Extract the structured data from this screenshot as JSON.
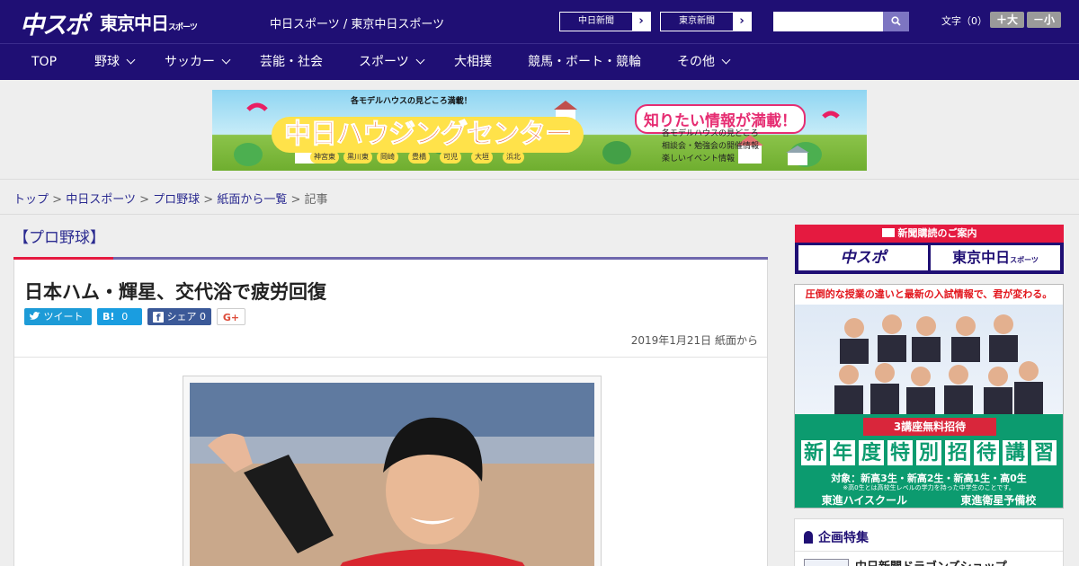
{
  "header": {
    "logo_chuspo": "中スポ",
    "logo_tokyo": "東京中日",
    "logo_tokyo_small": "スポーツ",
    "site_title": "中日スポーツ / 東京中日スポーツ",
    "ext_links": [
      "中日新聞",
      "東京新聞"
    ],
    "search_placeholder": "",
    "fontsize_label": "文字（0）",
    "fontsize_up": "＋大",
    "fontsize_down": "－小"
  },
  "nav": {
    "items": [
      {
        "label": "TOP",
        "has_menu": false
      },
      {
        "label": "野球",
        "has_menu": true
      },
      {
        "label": "サッカー",
        "has_menu": true
      },
      {
        "label": "芸能・社会",
        "has_menu": false
      },
      {
        "label": "スポーツ",
        "has_menu": true
      },
      {
        "label": "大相撲",
        "has_menu": false
      },
      {
        "label": "競馬・ボート・競輪",
        "has_menu": false
      },
      {
        "label": "その他",
        "has_menu": true
      }
    ]
  },
  "banner": {
    "top_text": "各モデルハウスの見どころ満載！",
    "title": "中日ハウジングセンター",
    "right_head": "知りたい情報が満載！",
    "lines": [
      "各モデルハウスの見どころ",
      "相談会・勉強会の開催情報",
      "楽しいイベント情報"
    ],
    "cities": [
      "神宮東",
      "黒川東",
      "岡崎",
      "豊橋",
      "可児",
      "大垣",
      "浜北"
    ]
  },
  "breadcrumb": {
    "items": [
      "トップ",
      "中日スポーツ",
      "プロ野球",
      "紙面から一覧"
    ],
    "current": "記事",
    "separator": ">"
  },
  "article": {
    "category": "【プロ野球】",
    "headline": "日本ハム・輝星、交代浴で疲労回復",
    "share": {
      "tweet": "ツイート",
      "hatena_label": "B!",
      "hatena_count": "0",
      "facebook": "シェア",
      "facebook_count": "0",
      "gplus": "G+"
    },
    "date": "2019年1月21日",
    "source": "紙面から"
  },
  "sidebar": {
    "subscribe_head": "新聞購読のご案内",
    "subscribe_left": "中スポ",
    "subscribe_right": "東京中日",
    "subscribe_right_small": "スポーツ",
    "ad2_top": "圧倒的な授業の違いと最新の入試情報で、君が変わる。",
    "ad2_free": "3講座無料招待",
    "ad2_big": [
      "新",
      "年",
      "度",
      "特",
      "別",
      "招",
      "待",
      "講",
      "習"
    ],
    "ad2_target": "対象：新高3生・新高2生・新高1生・高0生",
    "ad2_note": "※高0生とは高校生レベルの学力を持った中学生のことです。",
    "ad2_brand": [
      "東進ハイスクール",
      "東進衛星予備校"
    ],
    "feature_head": "企画特集",
    "feature_item": "中日新聞ドラゴンズショップ"
  },
  "colors": {
    "header_bg": "#1f0f74",
    "accent_red": "#e51a40",
    "link": "#2a2a90",
    "twitter": "#1d9bd7",
    "hatena": "#1a9de0",
    "facebook": "#3b5998"
  }
}
